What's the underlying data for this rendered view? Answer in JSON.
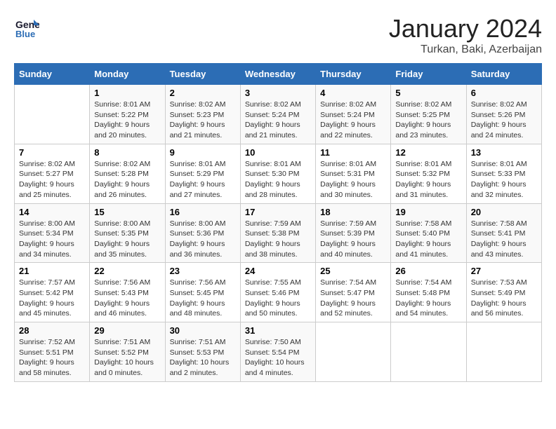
{
  "header": {
    "logo_line1": "General",
    "logo_line2": "Blue",
    "month": "January 2024",
    "location": "Turkan, Baki, Azerbaijan"
  },
  "weekdays": [
    "Sunday",
    "Monday",
    "Tuesday",
    "Wednesday",
    "Thursday",
    "Friday",
    "Saturday"
  ],
  "weeks": [
    [
      {
        "day": "",
        "sunrise": "",
        "sunset": "",
        "daylight": ""
      },
      {
        "day": "1",
        "sunrise": "Sunrise: 8:01 AM",
        "sunset": "Sunset: 5:22 PM",
        "daylight": "Daylight: 9 hours and 20 minutes."
      },
      {
        "day": "2",
        "sunrise": "Sunrise: 8:02 AM",
        "sunset": "Sunset: 5:23 PM",
        "daylight": "Daylight: 9 hours and 21 minutes."
      },
      {
        "day": "3",
        "sunrise": "Sunrise: 8:02 AM",
        "sunset": "Sunset: 5:24 PM",
        "daylight": "Daylight: 9 hours and 21 minutes."
      },
      {
        "day": "4",
        "sunrise": "Sunrise: 8:02 AM",
        "sunset": "Sunset: 5:24 PM",
        "daylight": "Daylight: 9 hours and 22 minutes."
      },
      {
        "day": "5",
        "sunrise": "Sunrise: 8:02 AM",
        "sunset": "Sunset: 5:25 PM",
        "daylight": "Daylight: 9 hours and 23 minutes."
      },
      {
        "day": "6",
        "sunrise": "Sunrise: 8:02 AM",
        "sunset": "Sunset: 5:26 PM",
        "daylight": "Daylight: 9 hours and 24 minutes."
      }
    ],
    [
      {
        "day": "7",
        "sunrise": "Sunrise: 8:02 AM",
        "sunset": "Sunset: 5:27 PM",
        "daylight": "Daylight: 9 hours and 25 minutes."
      },
      {
        "day": "8",
        "sunrise": "Sunrise: 8:02 AM",
        "sunset": "Sunset: 5:28 PM",
        "daylight": "Daylight: 9 hours and 26 minutes."
      },
      {
        "day": "9",
        "sunrise": "Sunrise: 8:01 AM",
        "sunset": "Sunset: 5:29 PM",
        "daylight": "Daylight: 9 hours and 27 minutes."
      },
      {
        "day": "10",
        "sunrise": "Sunrise: 8:01 AM",
        "sunset": "Sunset: 5:30 PM",
        "daylight": "Daylight: 9 hours and 28 minutes."
      },
      {
        "day": "11",
        "sunrise": "Sunrise: 8:01 AM",
        "sunset": "Sunset: 5:31 PM",
        "daylight": "Daylight: 9 hours and 30 minutes."
      },
      {
        "day": "12",
        "sunrise": "Sunrise: 8:01 AM",
        "sunset": "Sunset: 5:32 PM",
        "daylight": "Daylight: 9 hours and 31 minutes."
      },
      {
        "day": "13",
        "sunrise": "Sunrise: 8:01 AM",
        "sunset": "Sunset: 5:33 PM",
        "daylight": "Daylight: 9 hours and 32 minutes."
      }
    ],
    [
      {
        "day": "14",
        "sunrise": "Sunrise: 8:00 AM",
        "sunset": "Sunset: 5:34 PM",
        "daylight": "Daylight: 9 hours and 34 minutes."
      },
      {
        "day": "15",
        "sunrise": "Sunrise: 8:00 AM",
        "sunset": "Sunset: 5:35 PM",
        "daylight": "Daylight: 9 hours and 35 minutes."
      },
      {
        "day": "16",
        "sunrise": "Sunrise: 8:00 AM",
        "sunset": "Sunset: 5:36 PM",
        "daylight": "Daylight: 9 hours and 36 minutes."
      },
      {
        "day": "17",
        "sunrise": "Sunrise: 7:59 AM",
        "sunset": "Sunset: 5:38 PM",
        "daylight": "Daylight: 9 hours and 38 minutes."
      },
      {
        "day": "18",
        "sunrise": "Sunrise: 7:59 AM",
        "sunset": "Sunset: 5:39 PM",
        "daylight": "Daylight: 9 hours and 40 minutes."
      },
      {
        "day": "19",
        "sunrise": "Sunrise: 7:58 AM",
        "sunset": "Sunset: 5:40 PM",
        "daylight": "Daylight: 9 hours and 41 minutes."
      },
      {
        "day": "20",
        "sunrise": "Sunrise: 7:58 AM",
        "sunset": "Sunset: 5:41 PM",
        "daylight": "Daylight: 9 hours and 43 minutes."
      }
    ],
    [
      {
        "day": "21",
        "sunrise": "Sunrise: 7:57 AM",
        "sunset": "Sunset: 5:42 PM",
        "daylight": "Daylight: 9 hours and 45 minutes."
      },
      {
        "day": "22",
        "sunrise": "Sunrise: 7:56 AM",
        "sunset": "Sunset: 5:43 PM",
        "daylight": "Daylight: 9 hours and 46 minutes."
      },
      {
        "day": "23",
        "sunrise": "Sunrise: 7:56 AM",
        "sunset": "Sunset: 5:45 PM",
        "daylight": "Daylight: 9 hours and 48 minutes."
      },
      {
        "day": "24",
        "sunrise": "Sunrise: 7:55 AM",
        "sunset": "Sunset: 5:46 PM",
        "daylight": "Daylight: 9 hours and 50 minutes."
      },
      {
        "day": "25",
        "sunrise": "Sunrise: 7:54 AM",
        "sunset": "Sunset: 5:47 PM",
        "daylight": "Daylight: 9 hours and 52 minutes."
      },
      {
        "day": "26",
        "sunrise": "Sunrise: 7:54 AM",
        "sunset": "Sunset: 5:48 PM",
        "daylight": "Daylight: 9 hours and 54 minutes."
      },
      {
        "day": "27",
        "sunrise": "Sunrise: 7:53 AM",
        "sunset": "Sunset: 5:49 PM",
        "daylight": "Daylight: 9 hours and 56 minutes."
      }
    ],
    [
      {
        "day": "28",
        "sunrise": "Sunrise: 7:52 AM",
        "sunset": "Sunset: 5:51 PM",
        "daylight": "Daylight: 9 hours and 58 minutes."
      },
      {
        "day": "29",
        "sunrise": "Sunrise: 7:51 AM",
        "sunset": "Sunset: 5:52 PM",
        "daylight": "Daylight: 10 hours and 0 minutes."
      },
      {
        "day": "30",
        "sunrise": "Sunrise: 7:51 AM",
        "sunset": "Sunset: 5:53 PM",
        "daylight": "Daylight: 10 hours and 2 minutes."
      },
      {
        "day": "31",
        "sunrise": "Sunrise: 7:50 AM",
        "sunset": "Sunset: 5:54 PM",
        "daylight": "Daylight: 10 hours and 4 minutes."
      },
      {
        "day": "",
        "sunrise": "",
        "sunset": "",
        "daylight": ""
      },
      {
        "day": "",
        "sunrise": "",
        "sunset": "",
        "daylight": ""
      },
      {
        "day": "",
        "sunrise": "",
        "sunset": "",
        "daylight": ""
      }
    ]
  ]
}
